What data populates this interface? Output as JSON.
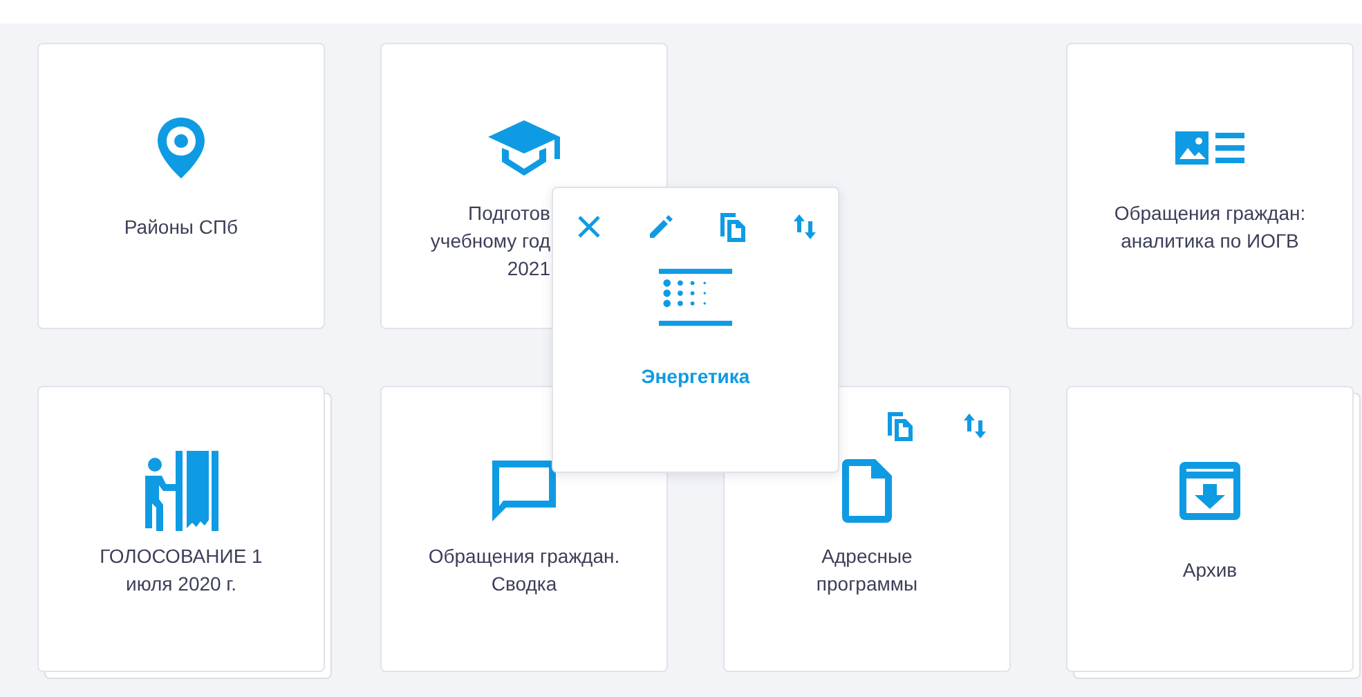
{
  "tiles": [
    {
      "kind": "tile",
      "lines": [
        "Районы СПб"
      ],
      "stacked": false,
      "covered": false
    },
    {
      "kind": "tile",
      "lines": [
        "Подготов",
        "учебному год",
        "2021"
      ],
      "stacked": false,
      "covered": true
    },
    {
      "kind": "empty"
    },
    {
      "kind": "tile",
      "lines": [
        "Обращения граждан:",
        "аналитика по ИОГВ"
      ],
      "stacked": false,
      "covered": false
    },
    {
      "kind": "tile",
      "lines": [
        "ГОЛОСОВАНИЕ 1",
        "июля 2020 г."
      ],
      "stacked": true,
      "covered": false
    },
    {
      "kind": "tile",
      "lines": [
        "Обращения граждан.",
        "Сводка"
      ],
      "stacked": false,
      "covered": false
    },
    {
      "kind": "tile",
      "lines": [
        "Адресные",
        "программы"
      ],
      "stacked": false,
      "covered": false,
      "actions": [
        {
          "kind": "copy"
        },
        {
          "kind": "move"
        }
      ]
    },
    {
      "kind": "tile",
      "lines": [
        "Архив"
      ],
      "stacked": true,
      "covered": false
    }
  ],
  "dragged_tile": {
    "lines": [
      "Энергетика"
    ],
    "actions": [
      {
        "kind": "delete"
      },
      {
        "kind": "edit"
      },
      {
        "kind": "copy"
      },
      {
        "kind": "move"
      }
    ]
  }
}
